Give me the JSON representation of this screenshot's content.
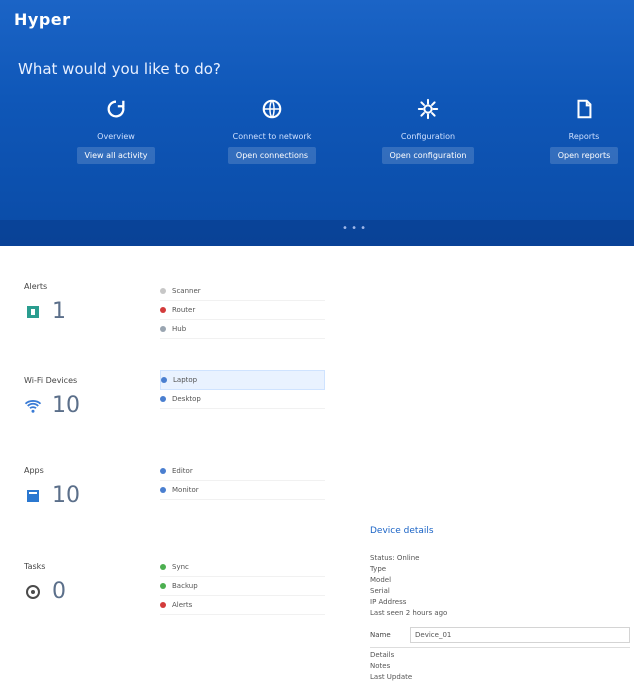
{
  "app": {
    "title": "Hyper",
    "tagline": "What would you like to do?"
  },
  "hero_tiles": [
    {
      "icon": "refresh-icon",
      "title": "Overview",
      "link": "View all activity"
    },
    {
      "icon": "globe-icon",
      "title": "Connect to network",
      "link": "Open connections"
    },
    {
      "icon": "settings-icon",
      "title": "Configuration",
      "link": "Open configuration"
    },
    {
      "icon": "document-icon",
      "title": "Reports",
      "link": "Open reports"
    }
  ],
  "stats": [
    {
      "label": "Alerts",
      "value": "1",
      "icon": "alert-icon"
    },
    {
      "label": "Wi-Fi Devices",
      "value": "10",
      "icon": "wifi-icon"
    },
    {
      "label": "Apps",
      "value": "10",
      "icon": "app-icon"
    },
    {
      "label": "Tasks",
      "value": "0",
      "icon": "task-icon"
    }
  ],
  "lists": [
    {
      "items": [
        {
          "dot": "#c7c7c7",
          "text": "Scanner"
        },
        {
          "dot": "#d33b3b",
          "text": "Router"
        },
        {
          "dot": "#9aa5b1",
          "text": "Hub"
        }
      ]
    },
    {
      "items": [
        {
          "dot": "#4a7fd0",
          "text": "Laptop"
        },
        {
          "dot": "#4a7fd0",
          "text": "Desktop"
        }
      ]
    },
    {
      "items": [
        {
          "dot": "#4a7fd0",
          "text": "Editor"
        },
        {
          "dot": "#4a7fd0",
          "text": "Monitor"
        }
      ]
    },
    {
      "items": [
        {
          "dot": "#4caf50",
          "text": "Sync"
        },
        {
          "dot": "#4caf50",
          "text": "Backup"
        },
        {
          "dot": "#d33b3b",
          "text": "Alerts"
        }
      ]
    }
  ],
  "details": {
    "title": "Device details",
    "rows": [
      "Status: Online",
      "Type",
      "Model",
      "Serial",
      "IP Address",
      "Last seen 2 hours ago"
    ],
    "input_label": "Name",
    "input_value": "Device_01",
    "more_rows": [
      "Details",
      "Notes",
      "Last Update"
    ]
  },
  "colors": {
    "hero": "#0f57b8",
    "accent": "#1b64c6"
  }
}
